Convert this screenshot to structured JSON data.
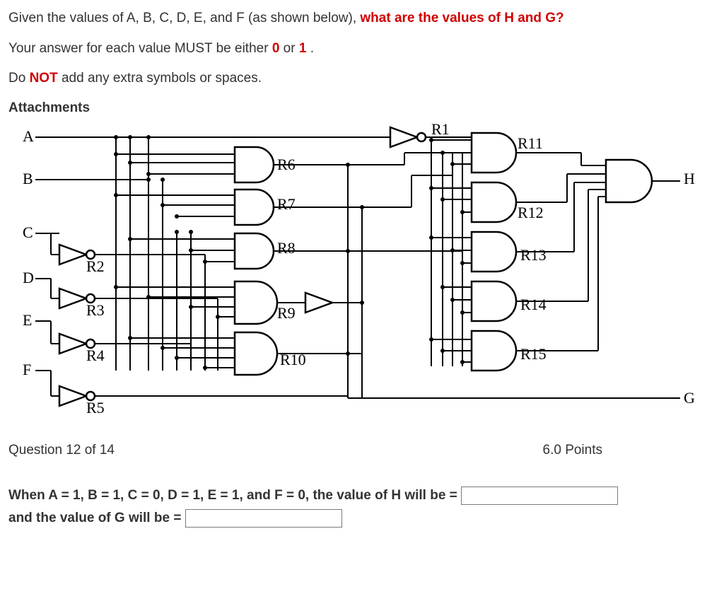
{
  "prompt": {
    "line1_prefix": "Given the values of A, B, C, D, E, and F (as shown below), ",
    "line1_highlight": "what are the values of H and G?",
    "line2_prefix": "Your answer for each value MUST be either ",
    "line2_zero": "0",
    "line2_or": " or ",
    "line2_one": "1",
    "line2_suffix": ".",
    "line3_prefix": "Do ",
    "line3_not": "NOT",
    "line3_suffix": " add any extra symbols or spaces.",
    "attachments_label": "Attachments"
  },
  "diagram": {
    "inputs": [
      "A",
      "B",
      "C",
      "D",
      "E",
      "F"
    ],
    "outputs": [
      "H",
      "G"
    ],
    "inverters": [
      "R1",
      "R2",
      "R3",
      "R4",
      "R5"
    ],
    "gates_col1": [
      "R6",
      "R7",
      "R8",
      "R9",
      "R10"
    ],
    "gates_col2": [
      "R11",
      "R12",
      "R13",
      "R14",
      "R15"
    ]
  },
  "footer": {
    "progress": "Question 12 of 14",
    "points": "6.0 Points"
  },
  "answer": {
    "text_before_H": "When A = 1, B = 1, C = 0, D = 1, E = 1, and F = 0, the value of H will be =",
    "text_before_G": "and the value of G will be ="
  }
}
